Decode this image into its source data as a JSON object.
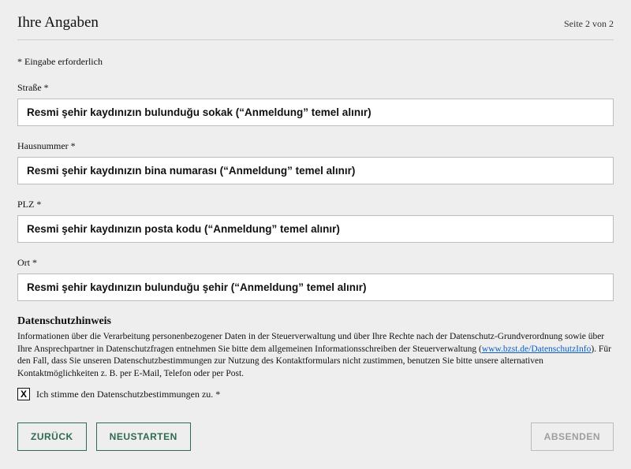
{
  "header": {
    "title": "Ihre Angaben",
    "page_indicator": "Seite 2 von 2"
  },
  "required_note": "* Eingabe erforderlich",
  "fields": {
    "street": {
      "label": "Straße *",
      "value": "Resmi şehir kaydınızın bulunduğu sokak (“Anmeldung” temel alınır)"
    },
    "housenumber": {
      "label": "Hausnummer *",
      "value": "Resmi şehir kaydınızın bina numarası (“Anmeldung” temel alınır)"
    },
    "plz": {
      "label": "PLZ *",
      "value": "Resmi şehir kaydınızın posta kodu (“Anmeldung” temel alınır)"
    },
    "ort": {
      "label": "Ort *",
      "value": "Resmi şehir kaydınızın bulunduğu şehir (“Anmeldung” temel alınır)"
    }
  },
  "privacy": {
    "heading": "Datenschutzhinweis",
    "text_before_link": "Informationen über die Verarbeitung personenbezogener Daten in der Steuerverwaltung und über Ihre Rechte nach der Datenschutz-Grundverordnung sowie über Ihre Ansprechpartner in Datenschutzfragen entnehmen Sie bitte dem allgemeinen Informationsschreiben der Steuerverwaltung (",
    "link_text": "www.bzst.de/DatenschutzInfo",
    "text_after_link": "). Für den Fall, dass Sie unseren Datenschutzbestimmungen zur Nutzung des Kontaktformulars nicht zustimmen, benutzen Sie bitte unsere alternativen Kontaktmöglichkeiten z. B. per E-Mail, Telefon oder per Post.",
    "checkbox_label": "Ich stimme den Datenschutzbestimmungen zu. *",
    "checkbox_mark": "X"
  },
  "buttons": {
    "back": "ZURÜCK",
    "restart": "NEUSTARTEN",
    "submit": "ABSENDEN"
  }
}
